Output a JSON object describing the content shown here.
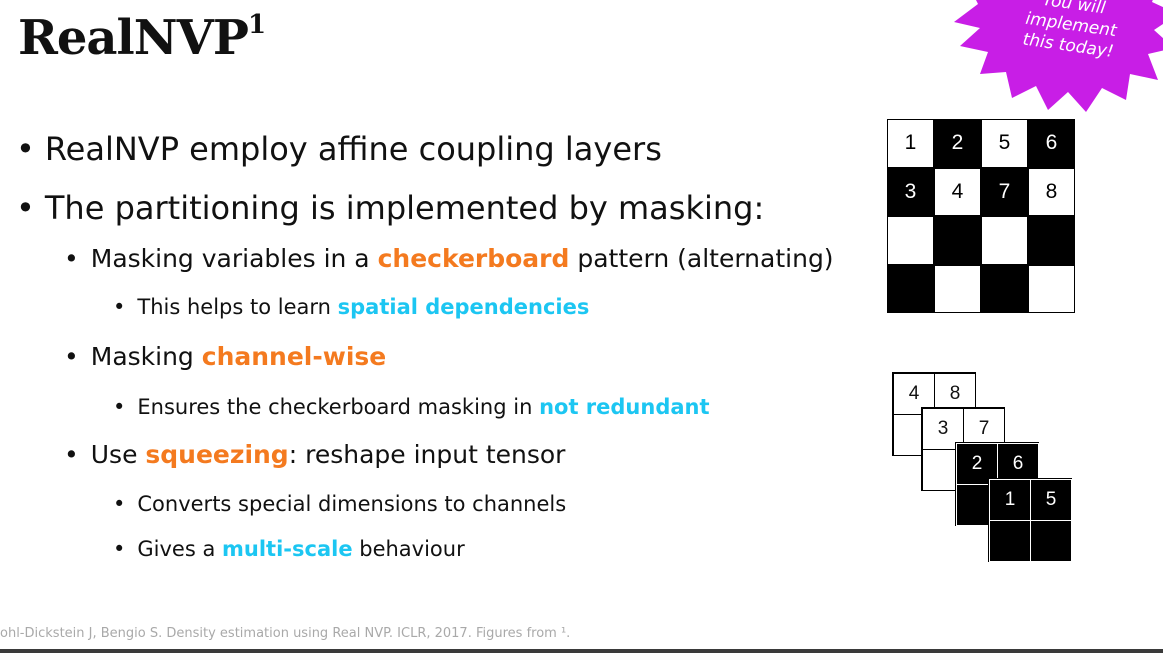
{
  "title": {
    "text": "RealNVP",
    "sup": "1"
  },
  "bullets": {
    "b1": "RealNVP employ affine coupling layers",
    "b2": "The partitioning is implemented by masking:",
    "b3": {
      "pre": "Masking variables in a ",
      "hl": "checkerboard",
      "post": " pattern (alternating)"
    },
    "b4": {
      "pre": "This helps to learn ",
      "hl": "spatial dependencies"
    },
    "b5": {
      "pre": "Masking ",
      "hl": "channel-wise"
    },
    "b6": {
      "pre": "Ensures the checkerboard masking in ",
      "hl": "not redundant"
    },
    "b7": {
      "pre": "Use ",
      "hl": "squeezing",
      "post": ": reshape input tensor"
    },
    "b8": "Converts special dimensions to channels",
    "b9": {
      "pre": "Gives a ",
      "hl": "multi-scale",
      "post": " behaviour"
    }
  },
  "bullet_symbol": "•",
  "badge": {
    "line1": "You will",
    "line2": "implement",
    "line3": "this today!",
    "color": "#c81ee6"
  },
  "checkerboard": {
    "row1": [
      "1",
      "2",
      "5",
      "6"
    ],
    "row2": [
      "3",
      "4",
      "7",
      "8"
    ]
  },
  "squeeze": {
    "t1": [
      "4",
      "8"
    ],
    "t2": [
      "3",
      "7"
    ],
    "t3": [
      "2",
      "6"
    ],
    "t4": [
      "1",
      "5"
    ]
  },
  "footnote": "ohl-Dickstein J, Bengio S. Density estimation using Real NVP. ICLR, 2017.  Figures from ¹."
}
